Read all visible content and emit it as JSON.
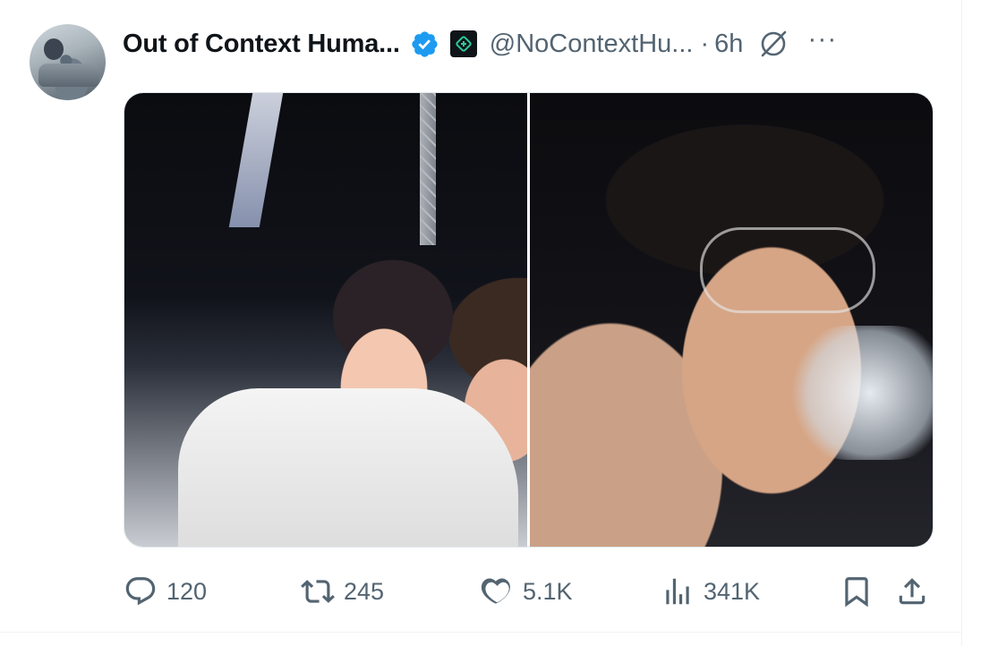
{
  "tweet": {
    "author": {
      "display_name": "Out of Context Huma...",
      "handle": "@NoContextHu...",
      "verified": true
    },
    "separator": "·",
    "timestamp": "6h",
    "more_label": "···",
    "media": [
      {
        "label": "photo-1"
      },
      {
        "label": "photo-2"
      }
    ],
    "actions": {
      "reply_count": "120",
      "repost_count": "245",
      "like_count": "5.1K",
      "view_count": "341K"
    }
  },
  "icons": {
    "verified": "verified-badge-icon",
    "affiliate": "affiliate-logo-icon",
    "grok": "grok-icon",
    "more": "more-icon",
    "reply": "reply-icon",
    "repost": "repost-icon",
    "like": "like-icon",
    "views": "views-icon",
    "bookmark": "bookmark-icon",
    "share": "share-icon"
  },
  "colors": {
    "text_primary": "#0f1419",
    "text_secondary": "#536471",
    "verified_blue": "#1d9bf0"
  }
}
